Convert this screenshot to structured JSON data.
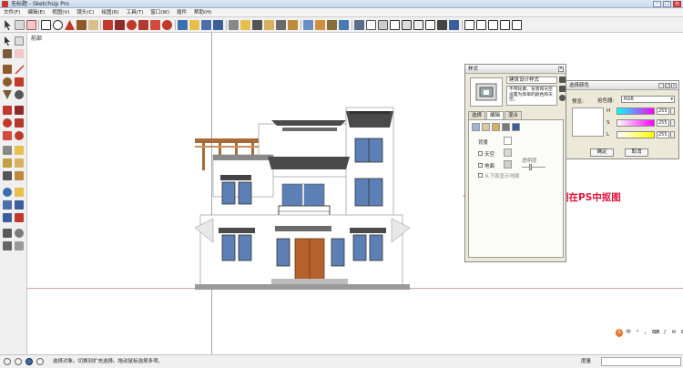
{
  "window": {
    "title": "无标题 - SketchUp Pro"
  },
  "menu": {
    "items": [
      "文件(F)",
      "编辑(E)",
      "视图(V)",
      "镜头(C)",
      "绘图(R)",
      "工具(T)",
      "窗口(W)",
      "插件",
      "帮助(H)"
    ]
  },
  "viewport": {
    "scene_label": "前部",
    "annotation": "调成白色原因：便于后期在PS中抠图"
  },
  "styles_panel": {
    "title": "样式",
    "style_name": "建筑设计样式",
    "style_description": "不带轮廓，背景和天空设置为简单的颜色和天空。",
    "tabs": [
      "选择",
      "编辑",
      "混合"
    ],
    "active_tab": "编辑",
    "background_label": "背景",
    "sky_label": "天空",
    "ground_label": "地面",
    "transparency_label": "透明度",
    "show_ground_from_below": "从下面显示地面"
  },
  "color_dialog": {
    "title": "选择颜色",
    "preview_label": "预览:",
    "mode_label": "拾色器:",
    "mode_value": "RGB",
    "channels": [
      {
        "label": "H",
        "value": "255"
      },
      {
        "label": "S",
        "value": "255"
      },
      {
        "label": "L",
        "value": "255"
      }
    ],
    "ok_label": "确定",
    "cancel_label": "取消"
  },
  "status": {
    "text": "选择对象。切换到扩充选择。拖动鼠标选择多项。",
    "measurements_label": "度量"
  },
  "ime": {
    "items": [
      "S",
      "中",
      "°",
      "，",
      "⌨",
      "♪",
      "✉",
      "⚙"
    ]
  },
  "colors": {
    "background": "#ffffff",
    "annotation": "#e0143c",
    "roof_tile": "#4a4a4a",
    "pergola": "#a86a36",
    "door": "#b5612c",
    "window_glass": "#5c7fb5",
    "blue_axis": "#9aa6c8",
    "red_axis": "#d4a2a2"
  }
}
